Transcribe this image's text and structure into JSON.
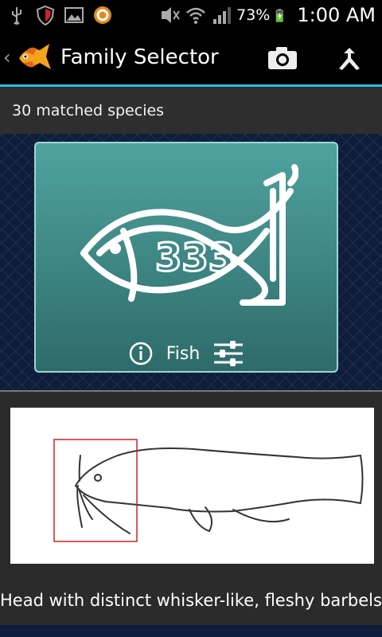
{
  "status_bar": {
    "icons": [
      "usb-icon",
      "shield-icon",
      "image-icon",
      "app-notification-icon",
      "mute-icon",
      "wifi-icon",
      "signal-icon",
      "battery-charging-icon"
    ],
    "battery_percent": "73%",
    "time": "1:00 AM"
  },
  "action_bar": {
    "title": "Family Selector",
    "icons": [
      "back-chevron-icon",
      "fish-logo-icon",
      "camera-icon",
      "merge-icon"
    ]
  },
  "subheader": {
    "match_count_text": "30 matched species"
  },
  "family_card": {
    "label": "Fish",
    "icons": [
      "info-icon",
      "fish-icon",
      "filter-sliders-icon"
    ]
  },
  "feature": {
    "caption": "Head with distinct whisker-like, fleshy barbels",
    "image_icon": "catfish-barbels-illustration"
  },
  "colors": {
    "accent_line": "#33b5e5",
    "card_top": "#4fa39f",
    "card_bottom": "#2e6b6a",
    "pattern_bg": "#0f1d3c",
    "highlight_box": "#cc2222"
  }
}
